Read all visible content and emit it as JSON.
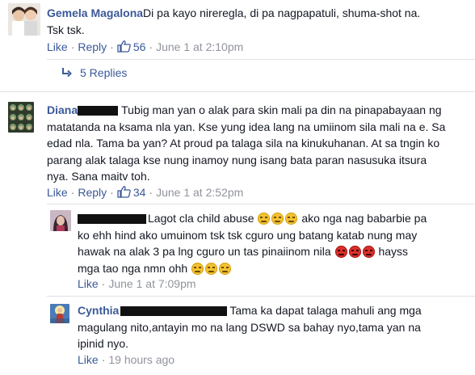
{
  "comments": [
    {
      "name": "Gemela Magalona",
      "text_lines": [
        "Di pa kayo nireregla, di pa nagpapatuli, shuma-shot na.",
        "Tsk tsk."
      ],
      "like_label": "Like",
      "reply_label": "Reply",
      "like_count": "56",
      "timestamp": "June 1 at 2:10pm"
    },
    {
      "name": "Diana",
      "text_lines": [
        "Tubig man yan o alak para skin mali pa din na pinapabayaan ng",
        "matatanda na ksama nla yan. Kse yung idea lang na umiinom sila mali na e. Sa",
        "edad nla. Tama ba yan? At proud pa talaga sila na kinukuhanan. At sa tngin ko",
        "parang alak talaga kse nung inamoy nung isang bata paran nasusuka itsura",
        "nya. Sana maitv toh."
      ],
      "like_label": "Like",
      "reply_label": "Reply",
      "like_count": "34",
      "timestamp": "June 1 at 2:52pm"
    }
  ],
  "replies_toggle": {
    "label": "5 Replies",
    "icon": "reply-arrow-icon"
  },
  "replies": [
    {
      "name": "",
      "text_a": "Lagot cla child abuse",
      "text_b": "ako nga nag babarbie pa",
      "text_lines": [
        "ko ehh hind ako umuinom tsk tsk cguro ung batang katab nung may",
        "hawak na alak 3 pa lng cguro un tas pinaiinom nila"
      ],
      "text_c": "hayss",
      "text_d": "mga tao nga nmn ohh",
      "like_label": "Like",
      "timestamp": "June 1 at 7:09pm"
    },
    {
      "name": "Cynthia",
      "text_lines": [
        "Tama ka dapat talaga mahuli ang mga",
        "magulang nito,antayin mo na lang DSWD sa bahay nyo,tama yan na",
        "ipinid nyo."
      ],
      "like_label": "Like",
      "timestamp": "19 hours ago"
    }
  ],
  "colors": {
    "link": "#3b5998",
    "text": "#141823",
    "muted": "#90949c",
    "divider": "#e1e2e3"
  }
}
